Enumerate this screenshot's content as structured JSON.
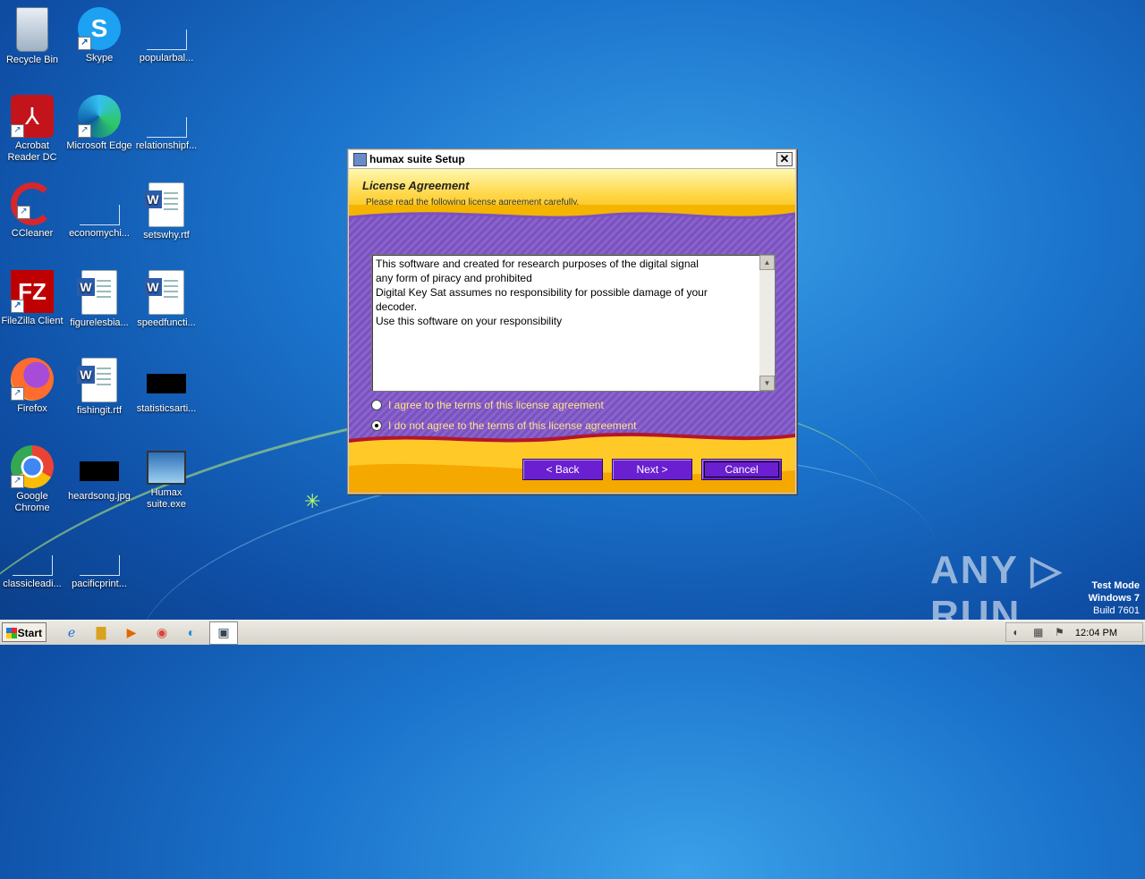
{
  "desktop": {
    "icons": [
      {
        "label": "Recycle Bin",
        "icon": "recycle-bin-icon"
      },
      {
        "label": "Skype",
        "icon": "skype-icon"
      },
      {
        "label": "popularbal...",
        "icon": "blank-file-icon"
      },
      {
        "label": "Acrobat Reader DC",
        "icon": "acrobat-icon"
      },
      {
        "label": "Microsoft Edge",
        "icon": "edge-icon"
      },
      {
        "label": "relationshipf...",
        "icon": "blank-file-icon"
      },
      {
        "label": "CCleaner",
        "icon": "ccleaner-icon"
      },
      {
        "label": "economychi...",
        "icon": "blank-file-icon"
      },
      {
        "label": "setswhy.rtf",
        "icon": "word-doc-icon"
      },
      {
        "label": "FileZilla Client",
        "icon": "filezilla-icon"
      },
      {
        "label": "figurelesbia...",
        "icon": "word-doc-icon"
      },
      {
        "label": "speedfuncti...",
        "icon": "word-doc-icon"
      },
      {
        "label": "Firefox",
        "icon": "firefox-icon"
      },
      {
        "label": "fishingit.rtf",
        "icon": "word-doc-icon"
      },
      {
        "label": "statisticsarti...",
        "icon": "image-file-icon"
      },
      {
        "label": "Google Chrome",
        "icon": "chrome-icon"
      },
      {
        "label": "heardsong.jpg",
        "icon": "image-file-icon"
      },
      {
        "label": "Humax suite.exe",
        "icon": "installer-icon"
      },
      {
        "label": "classicleadi...",
        "icon": "blank-file-icon"
      },
      {
        "label": "pacificprint...",
        "icon": "blank-file-icon"
      }
    ]
  },
  "dialog": {
    "title": "humax suite Setup",
    "close": "✕",
    "header_title": "License Agreement",
    "header_subtitle": "Please read the following license agreement carefully.",
    "license_text": "This software and created for research purposes of the digital signal\nany form of piracy and prohibited\nDigital Key Sat assumes no responsibility for possible damage of your\ndecoder.\nUse this software on your responsibility",
    "radio_agree": "I agree to the terms of this license agreement",
    "radio_disagree": "I do not agree to the terms of this license agreement",
    "selected": "disagree",
    "btn_back": "< Back",
    "btn_next": "Next >",
    "btn_cancel": "Cancel"
  },
  "watermark": "ANY ▷ RUN",
  "test_mode": {
    "line1": "Test Mode",
    "line2": "Windows 7",
    "line3": "Build 7601"
  },
  "taskbar": {
    "start": "Start",
    "clock": "12:04 PM"
  }
}
